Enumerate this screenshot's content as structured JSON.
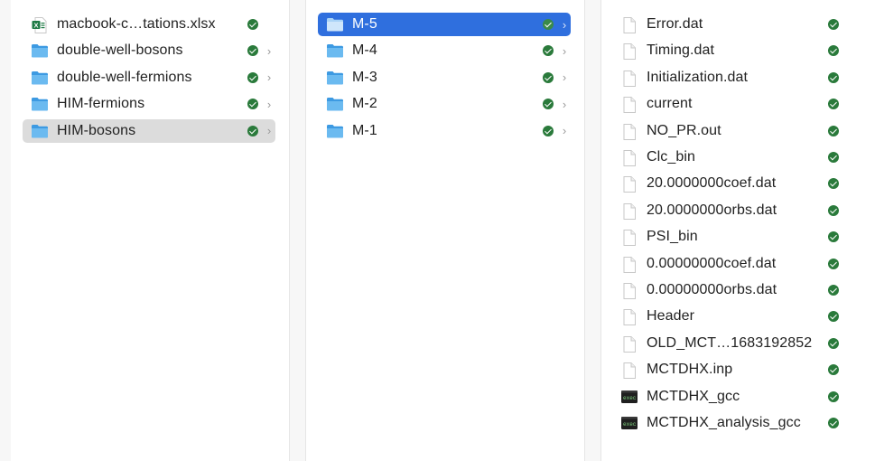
{
  "column1": {
    "items": [
      {
        "label": "macbook-c…tations.xlsx",
        "type": "excel",
        "chevron": false,
        "selected": false
      },
      {
        "label": "double-well-bosons",
        "type": "folder",
        "chevron": true,
        "selected": false
      },
      {
        "label": "double-well-fermions",
        "type": "folder",
        "chevron": true,
        "selected": false
      },
      {
        "label": "HIM-fermions",
        "type": "folder",
        "chevron": true,
        "selected": false
      },
      {
        "label": "HIM-bosons",
        "type": "folder",
        "chevron": true,
        "selected": true
      }
    ]
  },
  "column2": {
    "items": [
      {
        "label": "M-5",
        "type": "folder",
        "chevron": true,
        "selected": true
      },
      {
        "label": "M-4",
        "type": "folder",
        "chevron": true,
        "selected": false
      },
      {
        "label": "M-3",
        "type": "folder",
        "chevron": true,
        "selected": false
      },
      {
        "label": "M-2",
        "type": "folder",
        "chevron": true,
        "selected": false
      },
      {
        "label": "M-1",
        "type": "folder",
        "chevron": true,
        "selected": false
      }
    ]
  },
  "column3": {
    "items": [
      {
        "label": "Error.dat",
        "type": "document"
      },
      {
        "label": "Timing.dat",
        "type": "document"
      },
      {
        "label": "Initialization.dat",
        "type": "document"
      },
      {
        "label": "current",
        "type": "document"
      },
      {
        "label": "NO_PR.out",
        "type": "document"
      },
      {
        "label": "Clc_bin",
        "type": "document"
      },
      {
        "label": "20.0000000coef.dat",
        "type": "document"
      },
      {
        "label": "20.0000000orbs.dat",
        "type": "document"
      },
      {
        "label": "PSI_bin",
        "type": "document"
      },
      {
        "label": "0.00000000coef.dat",
        "type": "document"
      },
      {
        "label": "0.00000000orbs.dat",
        "type": "document"
      },
      {
        "label": "Header",
        "type": "document"
      },
      {
        "label": "OLD_MCT…1683192852",
        "type": "document"
      },
      {
        "label": "MCTDHX.inp",
        "type": "document"
      },
      {
        "label": "MCTDHX_gcc",
        "type": "executable"
      },
      {
        "label": "MCTDHX_analysis_gcc",
        "type": "executable"
      }
    ]
  },
  "colors": {
    "selection_blue": "#2f6fde",
    "selection_gray": "#dcdcdc",
    "status_green": "#2a7a3b",
    "folder_blue": "#4aa8e8"
  },
  "icons": {
    "excel": "excel-file-icon",
    "folder": "folder-icon",
    "document": "document-icon",
    "executable": "terminal-executable-icon",
    "status": "synced-check-icon",
    "chevron": "chevron-right-icon"
  }
}
